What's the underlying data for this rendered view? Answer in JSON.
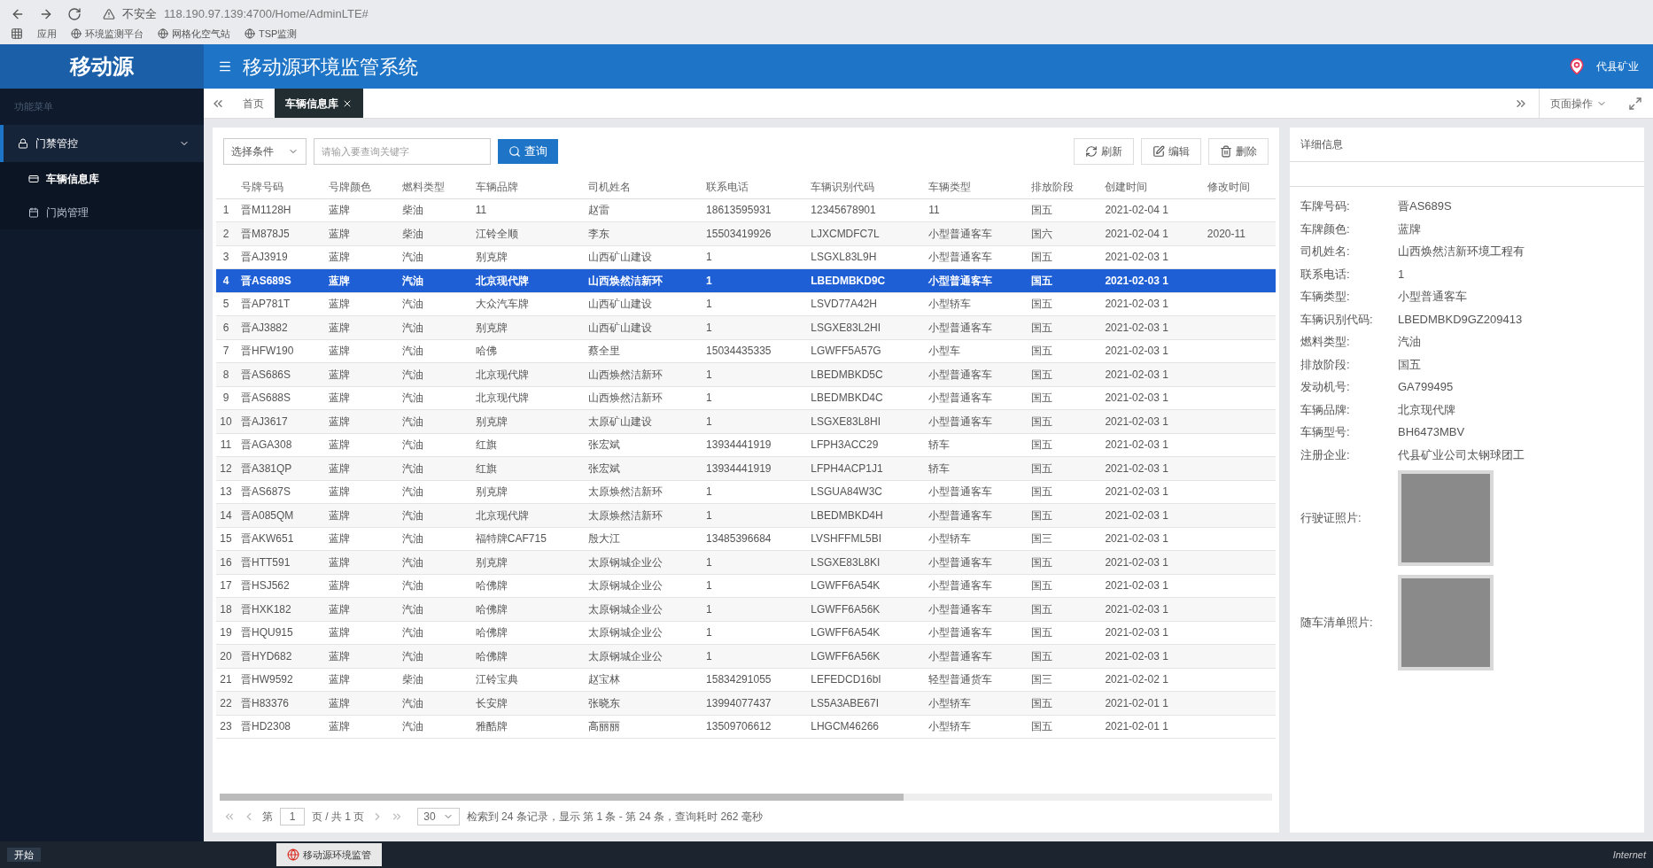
{
  "browser": {
    "security": "不安全",
    "url": "118.190.97.139:4700/Home/AdminLTE#",
    "bookmarks": [
      "应用",
      "环境监测平台",
      "网格化空气站",
      "TSP监测"
    ]
  },
  "header": {
    "logo": "移动源",
    "title": "移动源环境监管系统",
    "user": "代县矿业",
    "page_menu": "页面操作"
  },
  "sidebar": {
    "section": "功能菜单",
    "groups": [
      {
        "label": "门禁管控",
        "expanded": true,
        "children": [
          {
            "label": "车辆信息库",
            "selected": true
          },
          {
            "label": "门岗管理",
            "selected": false
          }
        ]
      }
    ]
  },
  "tabs": [
    {
      "label": "首页",
      "selected": false,
      "closable": false
    },
    {
      "label": "车辆信息库",
      "selected": true,
      "closable": true
    }
  ],
  "toolbar": {
    "condition": "选择条件",
    "placeholder": "请输入要查询关键字",
    "search": "查询",
    "actions": [
      {
        "kind": "refresh",
        "label": "刷新"
      },
      {
        "kind": "edit",
        "label": "编辑"
      },
      {
        "kind": "delete",
        "label": "删除"
      }
    ]
  },
  "table": {
    "columns": [
      "号牌号码",
      "号牌颜色",
      "燃料类型",
      "车辆品牌",
      "司机姓名",
      "联系电话",
      "车辆识别代码",
      "车辆类型",
      "排放阶段",
      "创建时间",
      "修改时间"
    ],
    "rows": [
      {
        "index": "1",
        "selected": false,
        "cells": [
          "晋M1128H",
          "蓝牌",
          "柴油",
          "11",
          "赵雷",
          "18613595931",
          "12345678901",
          "11",
          "国五",
          "2021-02-04 1",
          ""
        ]
      },
      {
        "index": "2",
        "selected": false,
        "cells": [
          "晋M878J5",
          "蓝牌",
          "柴油",
          "江铃全顺",
          "李东",
          "15503419926",
          "LJXCMDFC7L",
          "小型普通客车",
          "国六",
          "2021-02-04 1",
          "2020-11"
        ]
      },
      {
        "index": "3",
        "selected": false,
        "cells": [
          "晋AJ3919",
          "蓝牌",
          "汽油",
          "别克牌",
          "山西矿山建设",
          "1",
          "LSGXL83L9H",
          "小型普通客车",
          "国五",
          "2021-02-03 1",
          ""
        ]
      },
      {
        "index": "4",
        "selected": true,
        "cells": [
          "晋AS689S",
          "蓝牌",
          "汽油",
          "北京现代牌",
          "山西焕然洁新环",
          "1",
          "LBEDMBKD9C",
          "小型普通客车",
          "国五",
          "2021-02-03 1",
          ""
        ]
      },
      {
        "index": "5",
        "selected": false,
        "cells": [
          "晋AP781T",
          "蓝牌",
          "汽油",
          "大众汽车牌",
          "山西矿山建设",
          "1",
          "LSVD77A42H",
          "小型轿车",
          "国五",
          "2021-02-03 1",
          ""
        ]
      },
      {
        "index": "6",
        "selected": false,
        "cells": [
          "晋AJ3882",
          "蓝牌",
          "汽油",
          "别克牌",
          "山西矿山建设",
          "1",
          "LSGXE83L2HI",
          "小型普通客车",
          "国五",
          "2021-02-03 1",
          ""
        ]
      },
      {
        "index": "7",
        "selected": false,
        "cells": [
          "晋HFW190",
          "蓝牌",
          "汽油",
          "哈佛",
          "蔡全里",
          "15034435335",
          "LGWFF5A57G",
          "小型车",
          "国五",
          "2021-02-03 1",
          ""
        ]
      },
      {
        "index": "8",
        "selected": false,
        "cells": [
          "晋AS686S",
          "蓝牌",
          "汽油",
          "北京现代牌",
          "山西焕然洁新环",
          "1",
          "LBEDMBKD5C",
          "小型普通客车",
          "国五",
          "2021-02-03 1",
          ""
        ]
      },
      {
        "index": "9",
        "selected": false,
        "cells": [
          "晋AS688S",
          "蓝牌",
          "汽油",
          "北京现代牌",
          "山西焕然洁新环",
          "1",
          "LBEDMBKD4C",
          "小型普通客车",
          "国五",
          "2021-02-03 1",
          ""
        ]
      },
      {
        "index": "10",
        "selected": false,
        "cells": [
          "晋AJ3617",
          "蓝牌",
          "汽油",
          "别克牌",
          "太原矿山建设",
          "1",
          "LSGXE83L8HI",
          "小型普通客车",
          "国五",
          "2021-02-03 1",
          ""
        ]
      },
      {
        "index": "11",
        "selected": false,
        "cells": [
          "晋AGA308",
          "蓝牌",
          "汽油",
          "红旗",
          "张宏斌",
          "13934441919",
          "LFPH3ACC29",
          "轿车",
          "国五",
          "2021-02-03 1",
          ""
        ]
      },
      {
        "index": "12",
        "selected": false,
        "cells": [
          "晋A381QP",
          "蓝牌",
          "汽油",
          "红旗",
          "张宏斌",
          "13934441919",
          "LFPH4ACP1J1",
          "轿车",
          "国五",
          "2021-02-03 1",
          ""
        ]
      },
      {
        "index": "13",
        "selected": false,
        "cells": [
          "晋AS687S",
          "蓝牌",
          "汽油",
          "别克牌",
          "太原焕然洁新环",
          "1",
          "LSGUA84W3C",
          "小型普通客车",
          "国五",
          "2021-02-03 1",
          ""
        ]
      },
      {
        "index": "14",
        "selected": false,
        "cells": [
          "晋A085QM",
          "蓝牌",
          "汽油",
          "北京现代牌",
          "太原焕然洁新环",
          "1",
          "LBEDMBKD4H",
          "小型普通客车",
          "国五",
          "2021-02-03 1",
          ""
        ]
      },
      {
        "index": "15",
        "selected": false,
        "cells": [
          "晋AKW651",
          "蓝牌",
          "汽油",
          "福特牌CAF715",
          "殷大江",
          "13485396684",
          "LVSHFFML5BI",
          "小型轿车",
          "国三",
          "2021-02-03 1",
          ""
        ]
      },
      {
        "index": "16",
        "selected": false,
        "cells": [
          "晋HTT591",
          "蓝牌",
          "汽油",
          "别克牌",
          "太原钢城企业公",
          "1",
          "LSGXE83L8KI",
          "小型普通客车",
          "国五",
          "2021-02-03 1",
          ""
        ]
      },
      {
        "index": "17",
        "selected": false,
        "cells": [
          "晋HSJ562",
          "蓝牌",
          "汽油",
          "哈佛牌",
          "太原钢城企业公",
          "1",
          "LGWFF6A54K",
          "小型普通客车",
          "国五",
          "2021-02-03 1",
          ""
        ]
      },
      {
        "index": "18",
        "selected": false,
        "cells": [
          "晋HXK182",
          "蓝牌",
          "汽油",
          "哈佛牌",
          "太原钢城企业公",
          "1",
          "LGWFF6A56K",
          "小型普通客车",
          "国五",
          "2021-02-03 1",
          ""
        ]
      },
      {
        "index": "19",
        "selected": false,
        "cells": [
          "晋HQU915",
          "蓝牌",
          "汽油",
          "哈佛牌",
          "太原钢城企业公",
          "1",
          "LGWFF6A54K",
          "小型普通客车",
          "国五",
          "2021-02-03 1",
          ""
        ]
      },
      {
        "index": "20",
        "selected": false,
        "cells": [
          "晋HYD682",
          "蓝牌",
          "汽油",
          "哈佛牌",
          "太原钢城企业公",
          "1",
          "LGWFF6A56K",
          "小型普通客车",
          "国五",
          "2021-02-03 1",
          ""
        ]
      },
      {
        "index": "21",
        "selected": false,
        "cells": [
          "晋HW9592",
          "蓝牌",
          "柴油",
          "江铃宝典",
          "赵宝林",
          "15834291055",
          "LEFEDCD16bI",
          "轻型普通货车",
          "国三",
          "2021-02-02 1",
          ""
        ]
      },
      {
        "index": "22",
        "selected": false,
        "cells": [
          "晋H83376",
          "蓝牌",
          "汽油",
          "长安牌",
          "张晓东",
          "13994077437",
          "LS5A3ABE67I",
          "小型轿车",
          "国五",
          "2021-02-01 1",
          ""
        ]
      },
      {
        "index": "23",
        "selected": false,
        "cells": [
          "晋HD2308",
          "蓝牌",
          "汽油",
          "雅酷牌",
          "高丽丽",
          "13509706612",
          "LHGCM46266",
          "小型轿车",
          "国五",
          "2021-02-01 1",
          ""
        ]
      }
    ]
  },
  "pagination": {
    "page_prefix": "第",
    "page": "1",
    "page_suffix": "页 / 共 1 页",
    "page_size": "30",
    "summary": "检索到 24 条记录，显示 第 1 条 - 第 24 条，查询耗时 262 毫秒"
  },
  "details": {
    "title": "详细信息",
    "fields": [
      {
        "label": "车牌号码:",
        "value": "晋AS689S"
      },
      {
        "label": "车牌颜色:",
        "value": "蓝牌"
      },
      {
        "label": "司机姓名:",
        "value": "山西焕然洁新环境工程有"
      },
      {
        "label": "联系电话:",
        "value": "1"
      },
      {
        "label": "车辆类型:",
        "value": "小型普通客车"
      },
      {
        "label": "车辆识别代码:",
        "value": "LBEDMBKD9GZ209413"
      },
      {
        "label": "燃料类型:",
        "value": "汽油"
      },
      {
        "label": "排放阶段:",
        "value": "国五"
      },
      {
        "label": "发动机号:",
        "value": "GA799495"
      },
      {
        "label": "车辆品牌:",
        "value": "北京现代牌"
      },
      {
        "label": "车辆型号:",
        "value": "BH6473MBV"
      },
      {
        "label": "注册企业:",
        "value": "代县矿业公司太钢球团工"
      }
    ],
    "photos": [
      {
        "label": "行驶证照片:"
      },
      {
        "label": "随车清单照片:"
      }
    ]
  },
  "taskbar": {
    "start": "开始",
    "window": "移动源环境监管",
    "zone": "Internet"
  }
}
